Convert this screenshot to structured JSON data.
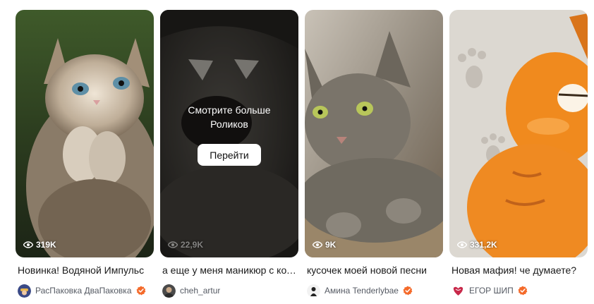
{
  "videos": [
    {
      "title": "Новинка! Водяной Импульс",
      "views": "319K",
      "author": "РасПаковка ДваПаковка",
      "verified": true,
      "thumbnail": "kitten-praying"
    },
    {
      "title": "а еще у меня маникюр с котом",
      "views": "22,9K",
      "author": "cheh_artur",
      "verified": false,
      "thumbnail": "dark-cat-closeup",
      "overlay": {
        "text": "Смотрите больше Роликов",
        "button_label": "Перейти"
      }
    },
    {
      "title": "кусочек моей новой песни",
      "views": "9K",
      "author": "Амина Tenderlybae",
      "verified": true,
      "thumbnail": "tabby-cat"
    },
    {
      "title": "Новая мафия! че думаете?",
      "views": "331,2K",
      "author": "ЕГОР ШИП",
      "verified": true,
      "thumbnail": "garfield"
    }
  ],
  "colors": {
    "verified_badge": "#f46a2a",
    "text_primary": "#1a1a1a",
    "text_secondary": "#555a63"
  },
  "icons": {
    "views": "eye-icon",
    "verified": "verified-badge-icon"
  }
}
